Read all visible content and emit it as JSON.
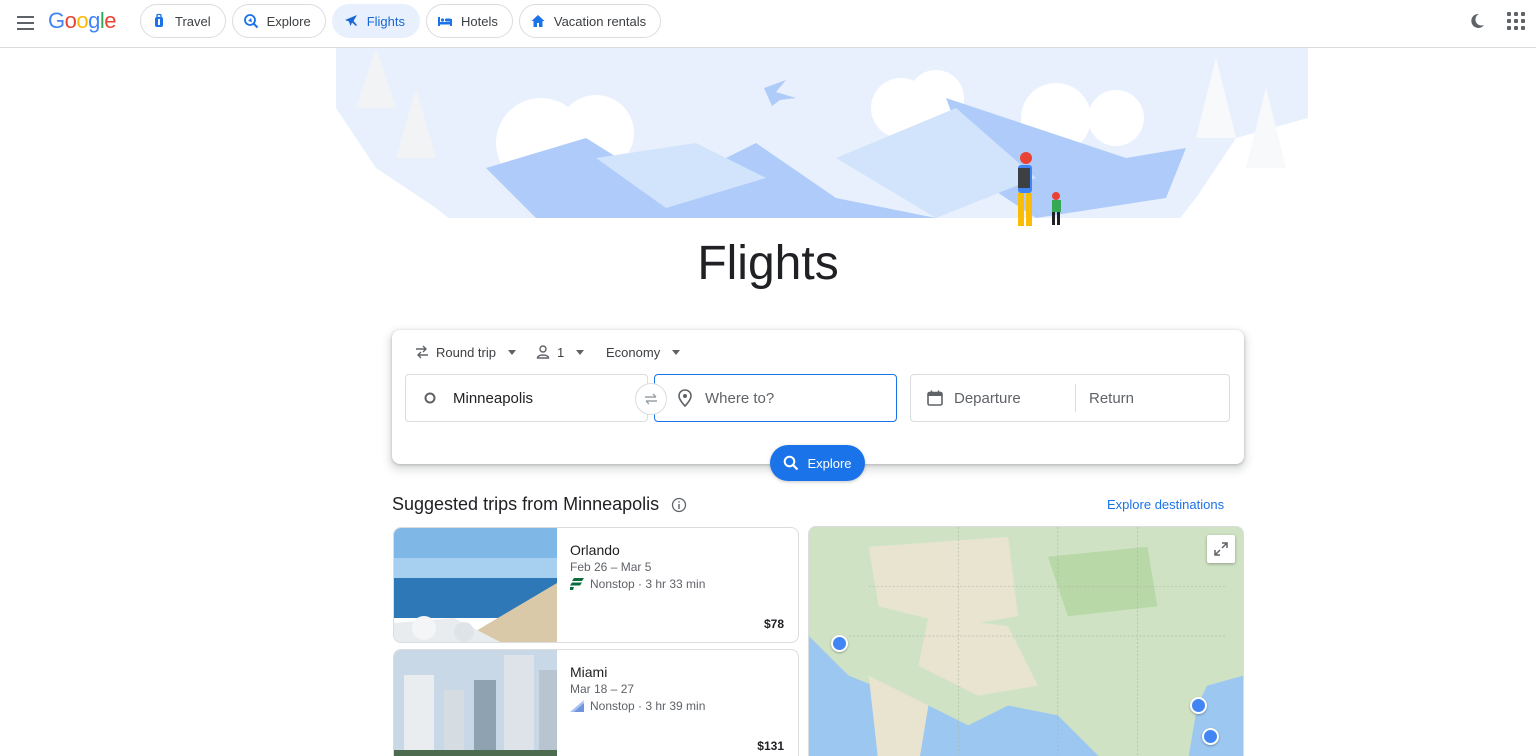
{
  "header": {
    "logo_text": "Google",
    "tabs": [
      {
        "label": "Travel",
        "icon": "suitcase-icon"
      },
      {
        "label": "Explore",
        "icon": "explore-search-icon"
      },
      {
        "label": "Flights",
        "icon": "airplane-icon",
        "active": true
      },
      {
        "label": "Hotels",
        "icon": "bed-icon"
      },
      {
        "label": "Vacation rentals",
        "icon": "house-icon"
      }
    ]
  },
  "hero": {
    "title": "Flights"
  },
  "search": {
    "trip_type": "Round trip",
    "passengers": "1",
    "cabin_class": "Economy",
    "origin": "Minneapolis",
    "destination_placeholder": "Where to?",
    "departure_placeholder": "Departure",
    "return_placeholder": "Return",
    "explore_button": "Explore"
  },
  "suggested": {
    "title": "Suggested trips from Minneapolis",
    "explore_link": "Explore destinations",
    "trips": [
      {
        "city": "Orlando",
        "dates": "Feb 26 – Mar 5",
        "info": "Nonstop · 3 hr 33 min",
        "price": "$78"
      },
      {
        "city": "Miami",
        "dates": "Mar 18 – 27",
        "info": "Nonstop · 3 hr 39 min",
        "price": "$131"
      }
    ]
  },
  "colors": {
    "accent": "#1a73e8",
    "active_tab_bg": "#e8f0fe",
    "map_land": "#cfe3c4",
    "map_water": "#9bc7f0"
  }
}
